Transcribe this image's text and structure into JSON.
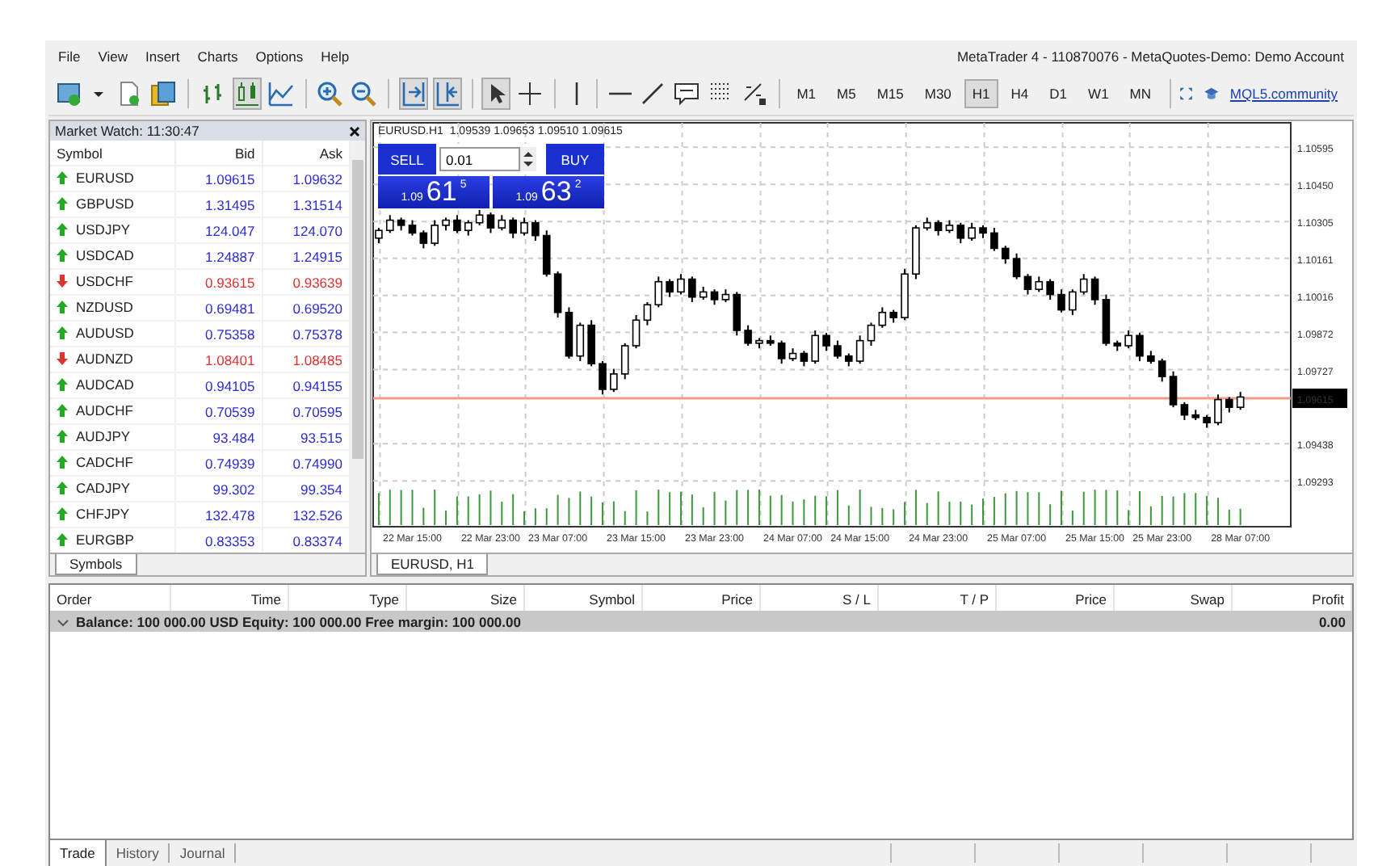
{
  "menu": [
    "File",
    "View",
    "Insert",
    "Charts",
    "Options",
    "Help"
  ],
  "window_title": "MetaTrader 4 - 110870076 - MetaQuotes-Demo: Demo Account",
  "toolbar": [
    {
      "kind": "new-chart",
      "pressed": false
    },
    {
      "kind": "dropdown",
      "pressed": false
    },
    {
      "kind": "document",
      "pressed": false
    },
    {
      "kind": "money",
      "pressed": false
    },
    {
      "kind": "sep"
    },
    {
      "kind": "bars",
      "pressed": false
    },
    {
      "kind": "candles",
      "pressed": true
    },
    {
      "kind": "line",
      "pressed": false
    },
    {
      "kind": "sep"
    },
    {
      "kind": "zoom-in",
      "pressed": false
    },
    {
      "kind": "zoom-out",
      "pressed": false
    },
    {
      "kind": "sep"
    },
    {
      "kind": "autoscroll",
      "pressed": true
    },
    {
      "kind": "shift",
      "pressed": true
    },
    {
      "kind": "sep"
    },
    {
      "kind": "cursor",
      "pressed": true
    },
    {
      "kind": "crosshair",
      "pressed": false
    },
    {
      "kind": "sep"
    },
    {
      "kind": "vline",
      "pressed": false
    },
    {
      "kind": "sep"
    },
    {
      "kind": "hline",
      "pressed": false
    },
    {
      "kind": "trendline",
      "pressed": false
    },
    {
      "kind": "text",
      "pressed": false
    },
    {
      "kind": "fibo",
      "pressed": false
    },
    {
      "kind": "fibo-e",
      "pressed": false
    },
    {
      "kind": "sep"
    }
  ],
  "timeframes": [
    {
      "label": "M1",
      "selected": false
    },
    {
      "label": "M5",
      "selected": false
    },
    {
      "label": "M15",
      "selected": false
    },
    {
      "label": "M30",
      "selected": false
    },
    {
      "label": "H1",
      "selected": true
    },
    {
      "label": "H4",
      "selected": false
    },
    {
      "label": "D1",
      "selected": false
    },
    {
      "label": "W1",
      "selected": false
    },
    {
      "label": "MN",
      "selected": false
    }
  ],
  "community_link": "MQL5.community",
  "market_watch": {
    "title": "Market Watch: 11:30:47",
    "columns": [
      "Symbol",
      "Bid",
      "Ask"
    ],
    "rows": [
      {
        "symbol": "EURUSD",
        "bid": "1.09615",
        "ask": "1.09632",
        "rising": true
      },
      {
        "symbol": "GBPUSD",
        "bid": "1.31495",
        "ask": "1.31514",
        "rising": true
      },
      {
        "symbol": "USDJPY",
        "bid": "124.047",
        "ask": "124.070",
        "rising": true
      },
      {
        "symbol": "USDCAD",
        "bid": "1.24887",
        "ask": "1.24915",
        "rising": true
      },
      {
        "symbol": "USDCHF",
        "bid": "0.93615",
        "ask": "0.93639",
        "rising": false
      },
      {
        "symbol": "NZDUSD",
        "bid": "0.69481",
        "ask": "0.69520",
        "rising": true
      },
      {
        "symbol": "AUDUSD",
        "bid": "0.75358",
        "ask": "0.75378",
        "rising": true
      },
      {
        "symbol": "AUDNZD",
        "bid": "1.08401",
        "ask": "1.08485",
        "rising": false
      },
      {
        "symbol": "AUDCAD",
        "bid": "0.94105",
        "ask": "0.94155",
        "rising": true
      },
      {
        "symbol": "AUDCHF",
        "bid": "0.70539",
        "ask": "0.70595",
        "rising": true
      },
      {
        "symbol": "AUDJPY",
        "bid": "93.484",
        "ask": "93.515",
        "rising": true
      },
      {
        "symbol": "CADCHF",
        "bid": "0.74939",
        "ask": "0.74990",
        "rising": true
      },
      {
        "symbol": "CADJPY",
        "bid": "99.302",
        "ask": "99.354",
        "rising": true
      },
      {
        "symbol": "CHFJPY",
        "bid": "132.478",
        "ask": "132.526",
        "rising": true
      },
      {
        "symbol": "EURGBP",
        "bid": "0.83353",
        "ask": "0.83374",
        "rising": true
      }
    ],
    "tab": "Symbols"
  },
  "chart": {
    "header": "EURUSD.H1  1.09539 1.09653 1.09510 1.09615",
    "sell": {
      "label": "SELL",
      "prefix": "1.09",
      "big": "61",
      "small": "5"
    },
    "buy": {
      "label": "BUY",
      "prefix": "1.09",
      "big": "63",
      "small": "2"
    },
    "lot": "0.01",
    "current_price": "1.09615",
    "tab": "EURUSD, H1",
    "chart_data": {
      "type": "candlestick",
      "ylim": [
        1.09114,
        1.1069
      ],
      "grid": true,
      "ref_lines": [
        {
          "axis": "y",
          "value": 1.09615,
          "color": "#f29b85"
        }
      ],
      "yticks": [
        {
          "value": 1.10595,
          "label": "1.10595"
        },
        {
          "value": 1.1045,
          "label": "1.10450"
        },
        {
          "value": 1.10305,
          "label": "1.10305"
        },
        {
          "value": 1.10161,
          "label": "1.10161"
        },
        {
          "value": 1.10016,
          "label": "1.10016"
        },
        {
          "value": 1.09872,
          "label": "1.09872"
        },
        {
          "value": 1.09727,
          "label": "1.09727"
        },
        {
          "value": 1.09438,
          "label": "1.09438"
        },
        {
          "value": 1.09293,
          "label": "1.09293"
        }
      ],
      "categories": [
        null,
        null,
        null,
        "22 Mar 15:00",
        null,
        null,
        null,
        null,
        null,
        null,
        "22 Mar 23:00",
        null,
        null,
        null,
        null,
        null,
        "23 Mar 07:00",
        null,
        null,
        null,
        null,
        null,
        null,
        "23 Mar 15:00",
        null,
        null,
        null,
        null,
        null,
        null,
        "23 Mar 23:00",
        null,
        null,
        null,
        null,
        null,
        null,
        "24 Mar 07:00",
        null,
        null,
        null,
        null,
        null,
        "24 Mar 15:00",
        null,
        null,
        null,
        null,
        null,
        null,
        "24 Mar 23:00",
        null,
        null,
        null,
        null,
        null,
        null,
        "25 Mar 07:00",
        null,
        null,
        null,
        null,
        null,
        null,
        "25 Mar 15:00",
        null,
        null,
        null,
        null,
        null,
        "25 Mar 23:00",
        null,
        null,
        null,
        null,
        null,
        null,
        "28 Mar 07:00",
        null,
        null,
        null,
        null
      ],
      "ohlc": [
        [
          1.1024,
          1.1028,
          1.1022,
          1.1027
        ],
        [
          1.1027,
          1.1033,
          1.1026,
          1.1031
        ],
        [
          1.1031,
          1.1032,
          1.1027,
          1.1029
        ],
        [
          1.1029,
          1.1031,
          1.1025,
          1.1026
        ],
        [
          1.1026,
          1.1027,
          1.102,
          1.1022
        ],
        [
          1.1022,
          1.1031,
          1.1021,
          1.1029
        ],
        [
          1.1029,
          1.1032,
          1.1027,
          1.1031
        ],
        [
          1.1031,
          1.1033,
          1.1026,
          1.1027
        ],
        [
          1.1027,
          1.1031,
          1.1025,
          1.103
        ],
        [
          1.103,
          1.1035,
          1.1029,
          1.1033
        ],
        [
          1.1033,
          1.1034,
          1.1026,
          1.1028
        ],
        [
          1.1028,
          1.1033,
          1.1027,
          1.1031
        ],
        [
          1.1031,
          1.1032,
          1.1024,
          1.1026
        ],
        [
          1.1026,
          1.1032,
          1.1025,
          1.103
        ],
        [
          1.103,
          1.1031,
          1.1023,
          1.1025
        ],
        [
          1.1025,
          1.1027,
          1.1009,
          1.101
        ],
        [
          1.101,
          1.1011,
          1.0993,
          1.0995
        ],
        [
          1.0995,
          1.0997,
          1.0977,
          1.0978
        ],
        [
          1.0978,
          1.0991,
          1.0976,
          1.099
        ],
        [
          1.099,
          1.0992,
          1.0974,
          1.0975
        ],
        [
          1.0975,
          1.0976,
          1.0963,
          1.0965
        ],
        [
          1.0965,
          1.0973,
          1.0964,
          1.0971
        ],
        [
          1.0971,
          1.0983,
          1.0969,
          1.0982
        ],
        [
          1.0982,
          1.0994,
          1.0981,
          1.0992
        ],
        [
          1.0992,
          1.0999,
          1.099,
          1.0998
        ],
        [
          1.0998,
          1.1009,
          1.0997,
          1.1007
        ],
        [
          1.1007,
          1.1008,
          1.1001,
          1.1003
        ],
        [
          1.1003,
          1.101,
          1.1002,
          1.1008
        ],
        [
          1.1008,
          1.1009,
          1.0999,
          1.1001
        ],
        [
          1.1001,
          1.1005,
          1.1,
          1.1003
        ],
        [
          1.1003,
          1.1004,
          1.0998,
          1.1
        ],
        [
          1.1,
          1.1004,
          1.0999,
          1.1002
        ],
        [
          1.1002,
          1.1003,
          1.0986,
          1.0988
        ],
        [
          1.0988,
          1.099,
          1.0982,
          1.0983
        ],
        [
          1.0983,
          1.0985,
          1.0981,
          1.0984
        ],
        [
          1.0984,
          1.0986,
          1.0982,
          1.0983
        ],
        [
          1.0983,
          1.0984,
          1.0975,
          1.0977
        ],
        [
          1.0977,
          1.0981,
          1.0976,
          1.0979
        ],
        [
          1.0979,
          1.098,
          1.0974,
          1.0976
        ],
        [
          1.0976,
          1.0988,
          1.0975,
          1.0986
        ],
        [
          1.0986,
          1.0987,
          1.098,
          1.0982
        ],
        [
          1.0982,
          1.0984,
          1.0977,
          1.0978
        ],
        [
          1.0978,
          1.0979,
          1.0974,
          1.0976
        ],
        [
          1.0976,
          1.0986,
          1.0975,
          1.0984
        ],
        [
          1.0984,
          1.0991,
          1.0982,
          1.099
        ],
        [
          1.099,
          1.0997,
          1.0989,
          1.0995
        ],
        [
          1.0995,
          1.0996,
          1.0991,
          1.0993
        ],
        [
          1.0993,
          1.1012,
          1.0992,
          1.101
        ],
        [
          1.101,
          1.1029,
          1.1008,
          1.1028
        ],
        [
          1.1028,
          1.1032,
          1.1027,
          1.103
        ],
        [
          1.103,
          1.1031,
          1.1025,
          1.1027
        ],
        [
          1.1027,
          1.1031,
          1.1026,
          1.1029
        ],
        [
          1.1029,
          1.103,
          1.1022,
          1.1024
        ],
        [
          1.1024,
          1.103,
          1.1023,
          1.1028
        ],
        [
          1.1028,
          1.1029,
          1.1024,
          1.1026
        ],
        [
          1.1026,
          1.1028,
          1.1019,
          1.102
        ],
        [
          1.102,
          1.1021,
          1.1014,
          1.1016
        ],
        [
          1.1016,
          1.1018,
          1.1008,
          1.1009
        ],
        [
          1.1009,
          1.101,
          1.1002,
          1.1004
        ],
        [
          1.1004,
          1.1009,
          1.1003,
          1.1007
        ],
        [
          1.1007,
          1.1008,
          1.1,
          1.1002
        ],
        [
          1.1002,
          1.1004,
          1.0995,
          1.0996
        ],
        [
          1.0996,
          1.1004,
          1.0994,
          1.1003
        ],
        [
          1.1003,
          1.101,
          1.1002,
          1.1008
        ],
        [
          1.1008,
          1.1009,
          1.0998,
          1.1
        ],
        [
          1.1,
          1.1002,
          1.0982,
          1.0983
        ],
        [
          1.0983,
          1.0984,
          1.098,
          1.0982
        ],
        [
          1.0982,
          1.0988,
          1.0981,
          1.0986
        ],
        [
          1.0986,
          1.0987,
          1.0976,
          1.0978
        ],
        [
          1.0978,
          1.098,
          1.0975,
          1.0976
        ],
        [
          1.0976,
          1.0977,
          1.0968,
          1.097
        ],
        [
          1.097,
          1.0972,
          1.0958,
          1.0959
        ],
        [
          1.0959,
          1.096,
          1.0953,
          1.0955
        ],
        [
          1.0955,
          1.0957,
          1.0953,
          1.0954
        ],
        [
          1.0954,
          1.0955,
          1.095,
          1.0952
        ],
        [
          1.0952,
          1.0963,
          1.0951,
          1.0961
        ],
        [
          1.0961,
          1.0962,
          1.0956,
          1.0958
        ],
        [
          1.0958,
          1.0964,
          1.0957,
          1.0962
        ],
        null,
        null,
        null,
        null
      ]
    }
  },
  "terminal": {
    "columns": [
      "Order",
      "Time",
      "Type",
      "Size",
      "Symbol",
      "Price",
      "S / L",
      "T / P",
      "Price",
      "Swap",
      "Profit"
    ],
    "balance": "Balance: 100 000.00 USD  Equity: 100 000.00  Free margin: 100 000.00",
    "profit": "0.00",
    "tabs": [
      {
        "label": "Trade",
        "selected": true
      },
      {
        "label": "History",
        "selected": false
      },
      {
        "label": "Journal",
        "selected": false
      }
    ]
  }
}
